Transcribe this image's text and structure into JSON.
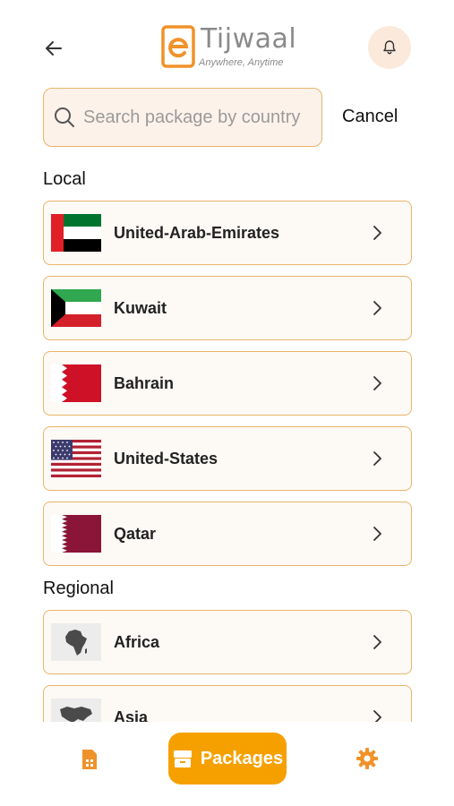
{
  "header": {
    "logo_name": "Tijwaal",
    "logo_tagline": "Anywhere, Anytime",
    "back_icon": "back-arrow-icon",
    "bell_icon": "bell-icon"
  },
  "search": {
    "placeholder": "Search package by country",
    "cancel_label": "Cancel"
  },
  "sections": {
    "local_title": "Local",
    "regional_title": "Regional"
  },
  "local": [
    {
      "label": "United-Arab-Emirates",
      "icon": "uae-flag-icon"
    },
    {
      "label": "Kuwait",
      "icon": "kuwait-flag-icon"
    },
    {
      "label": "Bahrain",
      "icon": "bahrain-flag-icon"
    },
    {
      "label": "United-States",
      "icon": "us-flag-icon"
    },
    {
      "label": "Qatar",
      "icon": "qatar-flag-icon"
    }
  ],
  "regional": [
    {
      "label": "Africa",
      "icon": "africa-map-icon"
    },
    {
      "label": "Asia",
      "icon": "asia-map-icon"
    }
  ],
  "bottom_nav": {
    "sim_icon": "sim-card-icon",
    "packages_label": "Packages",
    "packages_icon": "packages-icon",
    "settings_icon": "gear-icon"
  },
  "colors": {
    "accent": "#f6a000",
    "card_border": "#e8b56a",
    "card_bg": "#fdf9f5",
    "bell_bg": "#fbe9dc"
  }
}
